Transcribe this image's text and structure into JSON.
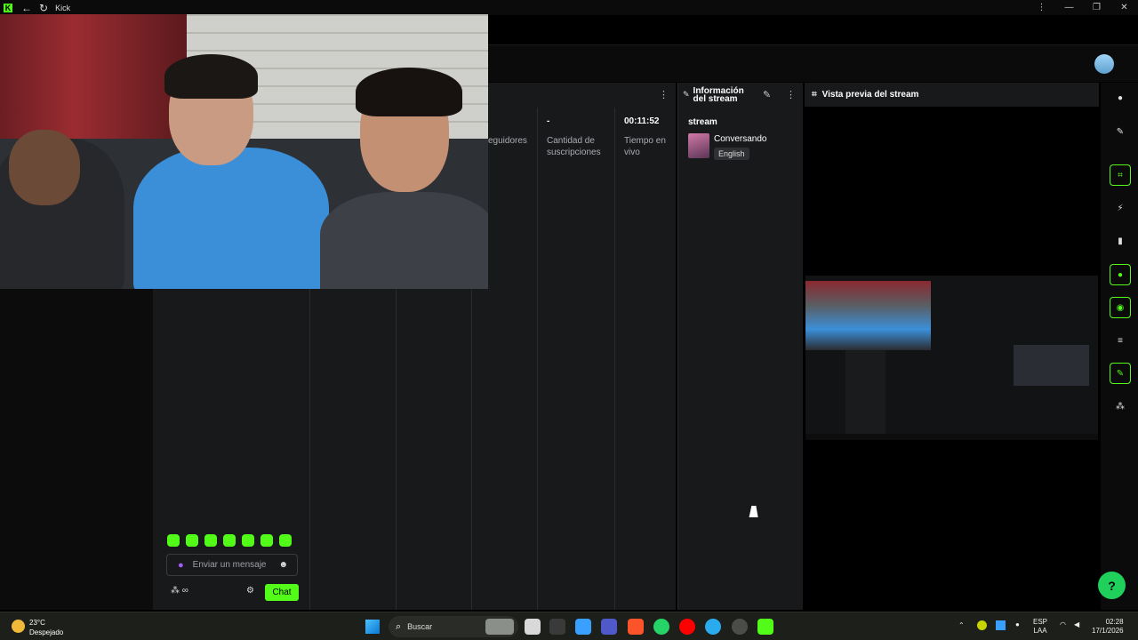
{
  "window": {
    "title": "Kick",
    "back": "←",
    "reload": "↻",
    "menu": "⋮",
    "minimize": "—",
    "restore": "❐",
    "close": "✕"
  },
  "stats": {
    "followers_label": "eguidores",
    "subs_value": "-",
    "subs_label": "Cantidad de suscripciones",
    "uptime_value": "00:11:52",
    "uptime_label": "Tiempo en vivo"
  },
  "info_panel": {
    "title": "Información del stream",
    "section": "stream",
    "category": "Conversando",
    "language_tag": "English"
  },
  "preview_panel": {
    "title": "Vista previa del stream"
  },
  "chat": {
    "placeholder": "Enviar un mensaje",
    "send_label": "Chat",
    "tools_label": "⁂ ∞",
    "emote_count": 7
  },
  "taskbar": {
    "temperature": "23°C",
    "weather": "Despejado",
    "search_label": "Buscar",
    "language": "ESP",
    "region": "LAA",
    "time": "02:28",
    "date": "17/1/2026"
  },
  "colors": {
    "accent": "#53fc18",
    "panel": "#18191b",
    "help": "#1fd05b"
  },
  "icons": [
    "info-icon",
    "pencil-icon",
    "expand-icon",
    "bolt-icon",
    "document-icon",
    "chat-icon",
    "broadcast-icon",
    "layers-icon",
    "wrench-icon",
    "share-icon"
  ]
}
